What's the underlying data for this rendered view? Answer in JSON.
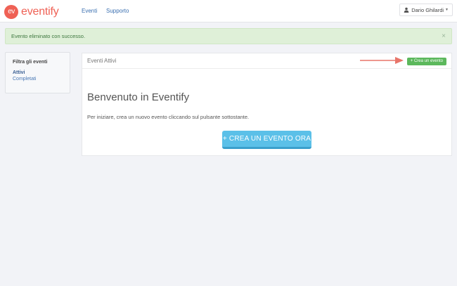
{
  "navbar": {
    "logo_badge": "ev",
    "logo_text": "eventify",
    "links": [
      "Eventi",
      "Supporto"
    ],
    "user_name": "Dario Ghilardi"
  },
  "alert": {
    "message": "Evento eliminato con successo.",
    "close": "×"
  },
  "sidebar": {
    "title": "Filtra gli eventi",
    "items": [
      {
        "label": "Attivi",
        "active": true
      },
      {
        "label": "Completati",
        "active": false
      }
    ]
  },
  "panel": {
    "title": "Eventi Attivi",
    "small_button": "+ Crea un evento",
    "heading": "Benvenuto in Eventify",
    "intro": "Per iniziare, crea un nuovo evento cliccando sul pulsante sottostante.",
    "big_button": "+ CREA UN EVENTO ORA"
  },
  "colors": {
    "brand": "#ef6155",
    "success_button": "#5cb85c",
    "primary_button": "#5bc0e8",
    "annotation_arrow": "#e8756a"
  },
  "icons": [
    "user-icon",
    "caret-down-icon",
    "close-icon",
    "plus-icon",
    "arrow-annotation-icon"
  ]
}
